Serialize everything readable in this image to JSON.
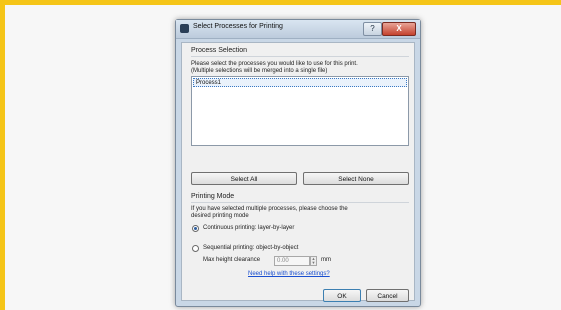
{
  "dialog": {
    "title": "Select Processes for Printing",
    "help_button": "?",
    "close_button": "X"
  },
  "process_selection": {
    "heading": "Process Selection",
    "description_line1": "Please select the processes you would like to use for this print.",
    "description_line2": "(Multiple selections will be merged into a single file)",
    "items": [
      "Process1"
    ],
    "select_all_label": "Select All",
    "select_none_label": "Select None"
  },
  "printing_mode": {
    "heading": "Printing Mode",
    "description_line1": "If you have selected multiple processes, please choose the",
    "description_line2": "desired printing mode",
    "option_continuous": "Continuous printing: layer-by-layer",
    "option_sequential": "Sequential printing: object-by-object",
    "selected": "continuous",
    "max_height_label": "Max height clearance",
    "max_height_value": "0.00",
    "max_height_unit": "mm",
    "help_link": "Need help with these settings?"
  },
  "footer": {
    "ok_label": "OK",
    "cancel_label": "Cancel"
  }
}
